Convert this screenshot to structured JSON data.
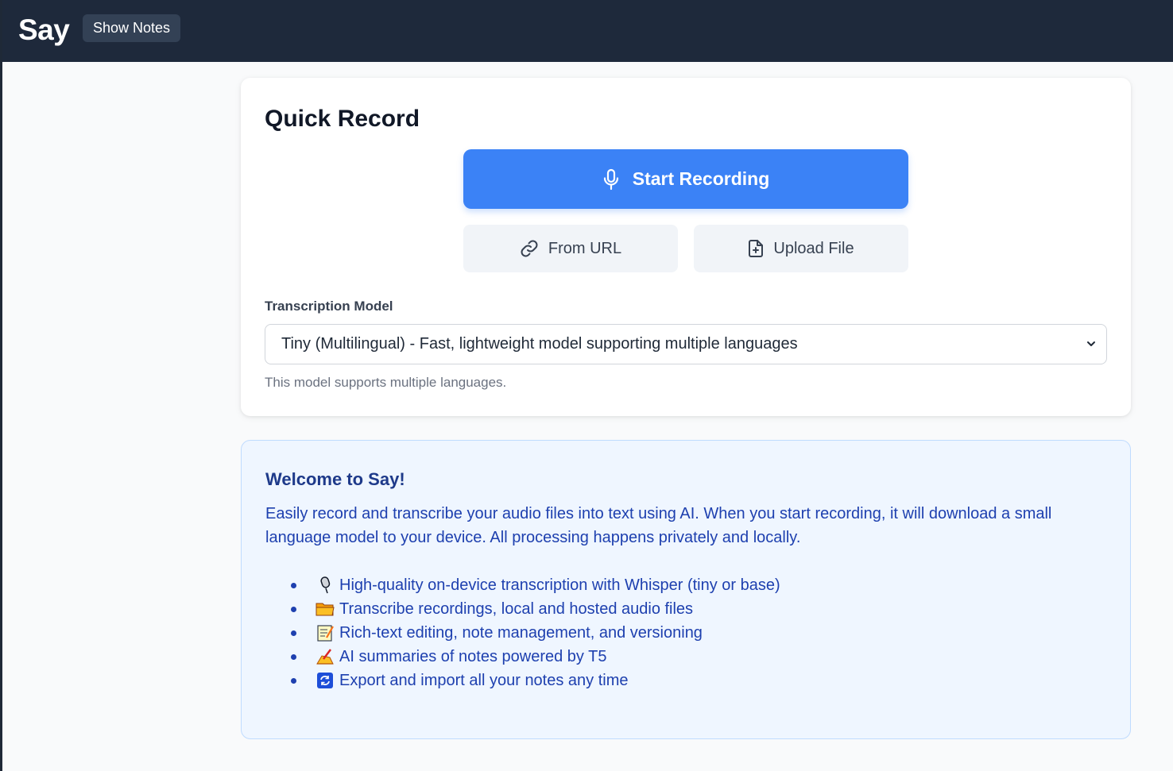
{
  "app": {
    "brand": "Say",
    "show_notes_label": "Show Notes"
  },
  "quick_record": {
    "title": "Quick Record",
    "start_label": "Start Recording",
    "from_url_label": "From URL",
    "upload_label": "Upload File",
    "model_label": "Transcription Model",
    "model_value": "Tiny (Multilingual) - Fast, lightweight model supporting multiple languages",
    "model_help": "This model supports multiple languages."
  },
  "welcome": {
    "title": "Welcome to Say!",
    "text": "Easily record and transcribe your audio files into text using AI. When you start recording, it will download a small language model to your device. All processing happens privately and locally.",
    "features": [
      {
        "icon": "microphone-emoji-icon",
        "text": "High-quality on-device transcription with Whisper (tiny or base)"
      },
      {
        "icon": "folder-emoji-icon",
        "text": "Transcribe recordings, local and hosted audio files"
      },
      {
        "icon": "memo-emoji-icon",
        "text": "Rich-text editing, note management, and versioning"
      },
      {
        "icon": "writing-hand-emoji-icon",
        "text": "AI summaries of notes powered by T5"
      },
      {
        "icon": "sync-emoji-icon",
        "text": "Export and import all your notes any time"
      }
    ]
  },
  "colors": {
    "topbar": "#1e293b",
    "primary": "#3b82f6",
    "welcome_bg": "#eff6ff",
    "welcome_text": "#1e40af"
  }
}
